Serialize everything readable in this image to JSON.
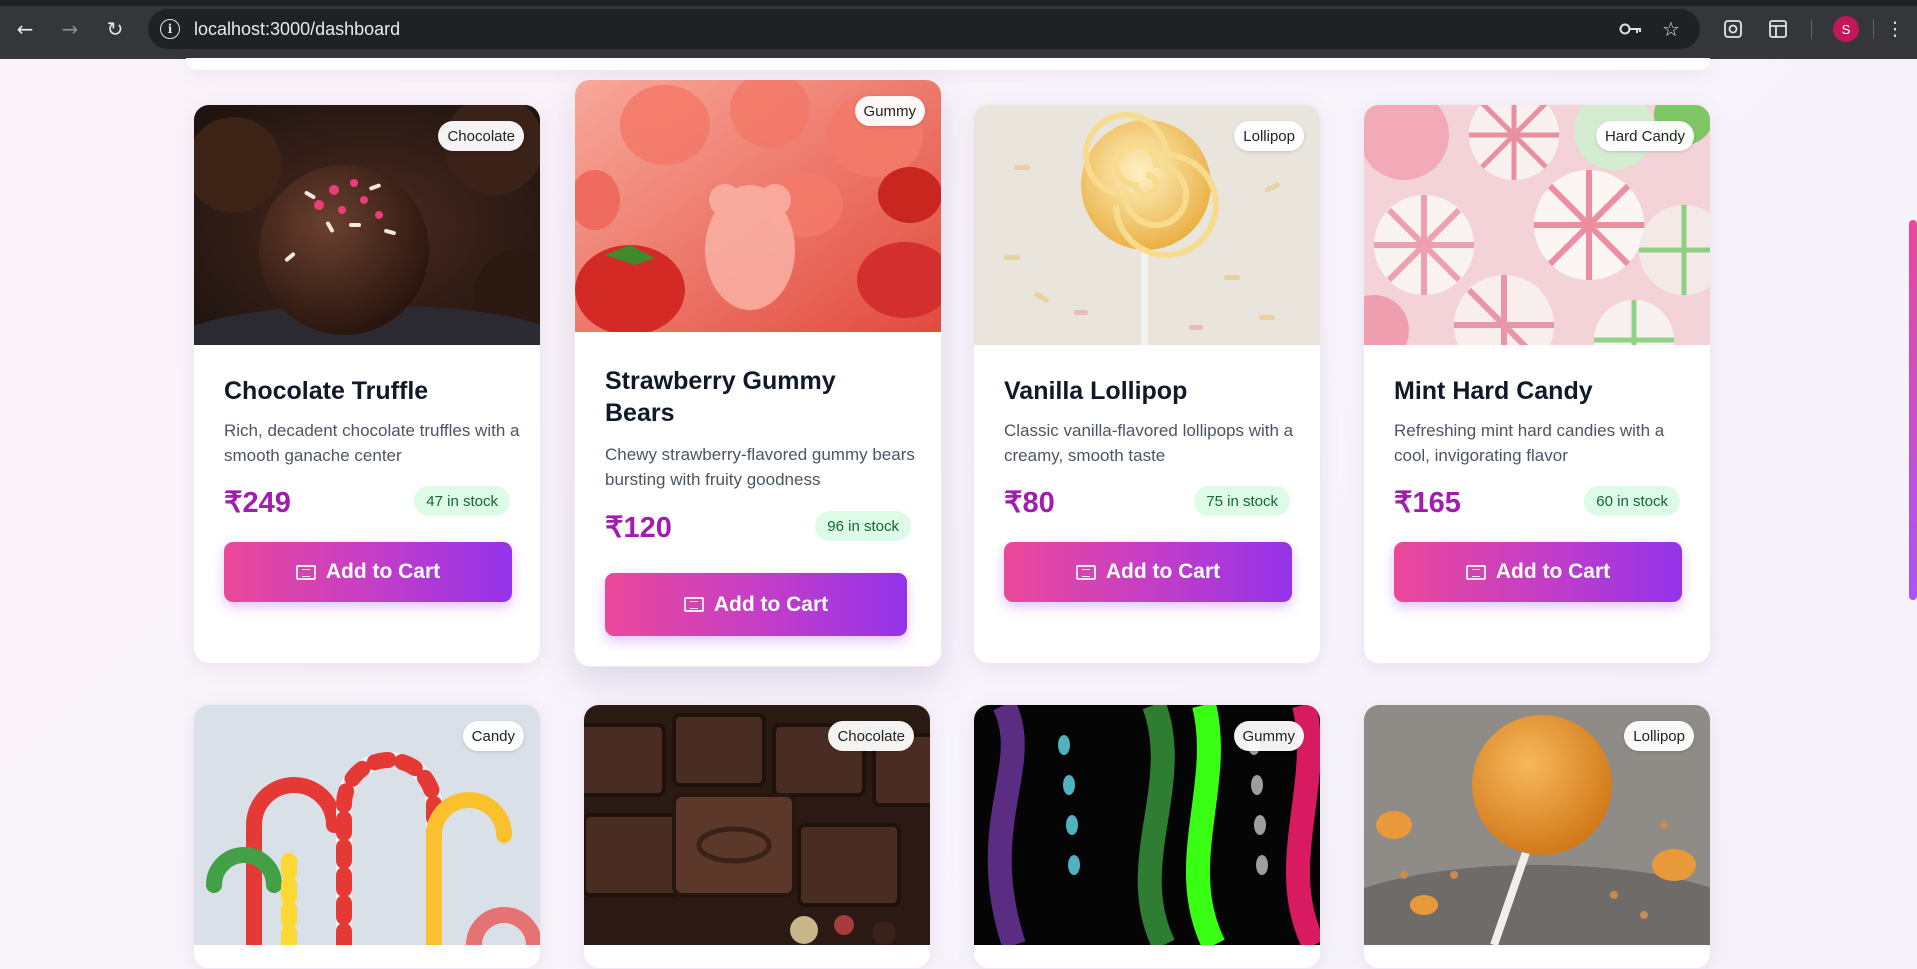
{
  "browser": {
    "url": "localhost:3000/dashboard",
    "profile_initial": "S",
    "icons": {
      "back": "arrow-left-icon",
      "forward": "arrow-right-icon",
      "reload": "reload-icon",
      "site_info": "info-icon",
      "password": "key-icon",
      "bookmark": "star-icon",
      "screenshot": "camera-icon",
      "tab_layout": "layout-icon",
      "menu": "kebab-menu-icon"
    }
  },
  "theme": {
    "accent_from": "#ec4899",
    "accent_to": "#9333ea",
    "price_color": "#a21caf",
    "stock_bg": "#dcfce7",
    "stock_text": "#166534"
  },
  "products": [
    {
      "category": "Chocolate",
      "name": "Chocolate Truffle",
      "description": "Rich, decadent chocolate truffles with a smooth ganache center",
      "price": "₹249",
      "stock": "47 in stock",
      "button": "Add to Cart"
    },
    {
      "category": "Gummy",
      "name": "Strawberry Gummy Bears",
      "description": "Chewy strawberry-flavored gummy bears bursting with fruity goodness",
      "price": "₹120",
      "stock": "96 in stock",
      "button": "Add to Cart"
    },
    {
      "category": "Lollipop",
      "name": "Vanilla Lollipop",
      "description": "Classic vanilla-flavored lollipops with a creamy, smooth taste",
      "price": "₹80",
      "stock": "75 in stock",
      "button": "Add to Cart"
    },
    {
      "category": "Hard Candy",
      "name": "Mint Hard Candy",
      "description": "Refreshing mint hard candies with a cool, invigorating flavor",
      "price": "₹165",
      "stock": "60 in stock",
      "button": "Add to Cart"
    },
    {
      "category": "Candy"
    },
    {
      "category": "Chocolate"
    },
    {
      "category": "Gummy"
    },
    {
      "category": "Lollipop"
    }
  ]
}
